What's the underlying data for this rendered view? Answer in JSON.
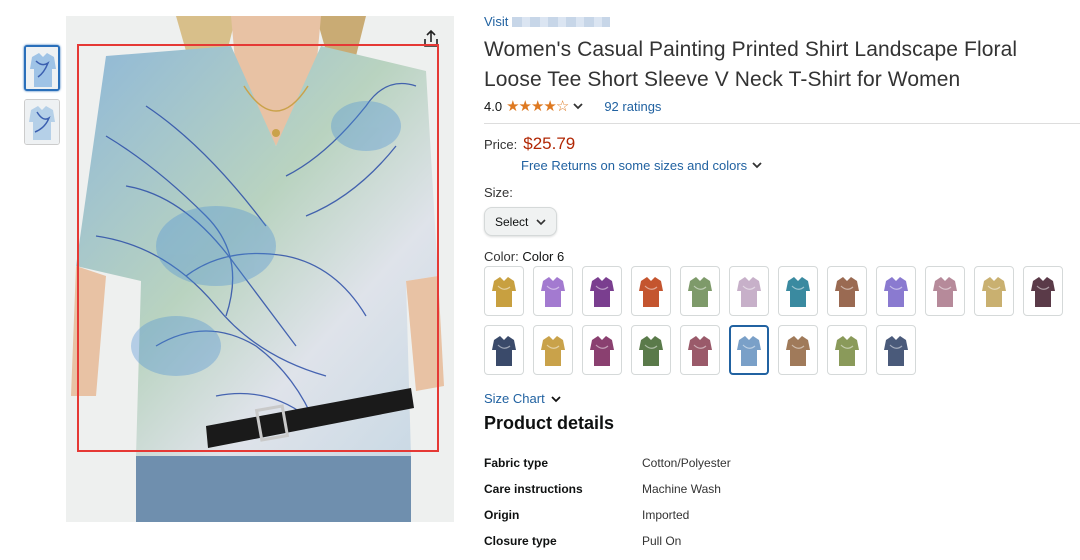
{
  "thumbnails": [
    {
      "name": "front",
      "selected": true
    },
    {
      "name": "side",
      "selected": false
    }
  ],
  "brand_link": {
    "prefix": "Visit"
  },
  "product": {
    "title_line1": "Women's Casual Painting Printed Shirt Landscape Floral",
    "title_line2": "Loose Tee Short Sleeve V Neck T-Shirt for Women",
    "rating_value": "4.0",
    "stars": 4,
    "ratings_count": "92 ratings"
  },
  "price": {
    "label": "Price:",
    "value": "$25.79",
    "returns": "Free Returns on some sizes and colors"
  },
  "size": {
    "label": "Size:",
    "select_value": "Select"
  },
  "color": {
    "label": "Color:",
    "selected": "Color 6"
  },
  "swatches_row1": [
    "#c8a040",
    "#a37ad0",
    "#7a3e8f",
    "#c4552f",
    "#7e9a6a",
    "#c7b0c9",
    "#3a8aa0",
    "#9a6a52",
    "#8a7ad0",
    "#b68a9a",
    "#c9b070",
    "#5a3a48"
  ],
  "swatches_row2": [
    "#3a4a6a",
    "#c9a24a",
    "#8a4070",
    "#5a7a4a",
    "#9a5a6a",
    "#7aa0c8",
    "#a07a5a",
    "#8a9a5a",
    "#4a5a7a"
  ],
  "colors": {
    "accent": "#2162a1",
    "price": "#b12704",
    "star": "#de7921",
    "crop_box": "#e53935"
  },
  "size_chart": "Size Chart",
  "details": {
    "heading": "Product details",
    "rows": [
      {
        "k": "Fabric type",
        "v": "Cotton/Polyester"
      },
      {
        "k": "Care instructions",
        "v": "Machine Wash"
      },
      {
        "k": "Origin",
        "v": "Imported"
      },
      {
        "k": "Closure type",
        "v": "Pull On"
      }
    ]
  }
}
